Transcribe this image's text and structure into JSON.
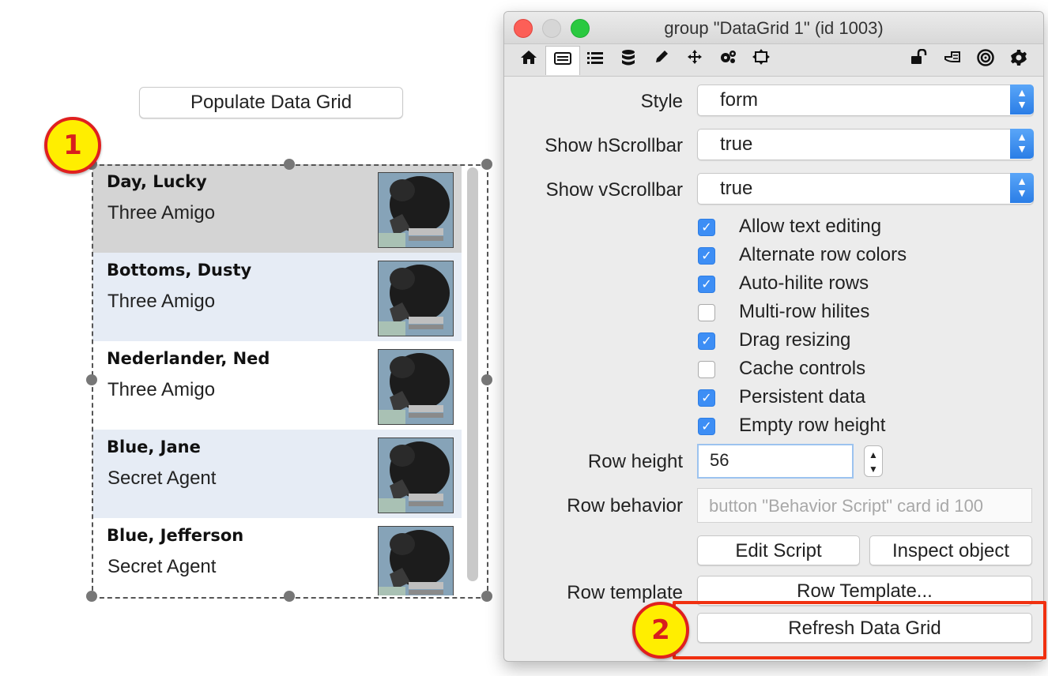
{
  "card": {
    "populate_button": "Populate Data Grid",
    "rows": [
      {
        "name": "Day, Lucky",
        "sub": "Three Amigo",
        "bg": "#d4d4d4"
      },
      {
        "name": "Bottoms, Dusty",
        "sub": "Three Amigo",
        "bg": "#e6ecf5"
      },
      {
        "name": "Nederlander, Ned",
        "sub": "Three Amigo",
        "bg": "#ffffff"
      },
      {
        "name": "Blue, Jane",
        "sub": "Secret Agent",
        "bg": "#e6ecf5"
      },
      {
        "name": "Blue, Jefferson",
        "sub": "Secret Agent",
        "bg": "#ffffff"
      }
    ],
    "badge_1": "1",
    "badge_2": "2"
  },
  "inspector": {
    "title": "group \"DataGrid 1\" (id 1003)",
    "toolbar_icons": [
      "home-icon",
      "basic-properties-icon",
      "list-icon",
      "database-icon",
      "pencil-icon",
      "move-icon",
      "gears-icon",
      "resize-icon",
      "lock-icon",
      "hand-icon",
      "target-icon",
      "gear-icon"
    ],
    "style_label": "Style",
    "style_value": "form",
    "hscroll_label": "Show hScrollbar",
    "hscroll_value": "true",
    "vscroll_label": "Show vScrollbar",
    "vscroll_value": "true",
    "checkboxes": [
      {
        "label": "Allow text editing",
        "checked": true
      },
      {
        "label": "Alternate row colors",
        "checked": true
      },
      {
        "label": "Auto-hilite rows",
        "checked": true
      },
      {
        "label": "Multi-row hilites",
        "checked": false
      },
      {
        "label": "Drag resizing",
        "checked": true
      },
      {
        "label": "Cache controls",
        "checked": false
      },
      {
        "label": "Persistent data",
        "checked": true
      },
      {
        "label": "Empty row height",
        "checked": true
      }
    ],
    "row_height_label": "Row height",
    "row_height_value": "56",
    "row_behavior_label": "Row behavior",
    "row_behavior_placeholder": "button \"Behavior Script\" card  id 100",
    "edit_script_button": "Edit Script",
    "inspect_object_button": "Inspect object",
    "row_template_label": "Row template",
    "row_template_button": "Row Template...",
    "refresh_button": "Refresh Data Grid"
  },
  "colors": {
    "accent": "#3d8ef5",
    "highlight_box": "#f03010",
    "badge_fill": "#ffee00",
    "badge_border": "#e0201f"
  }
}
